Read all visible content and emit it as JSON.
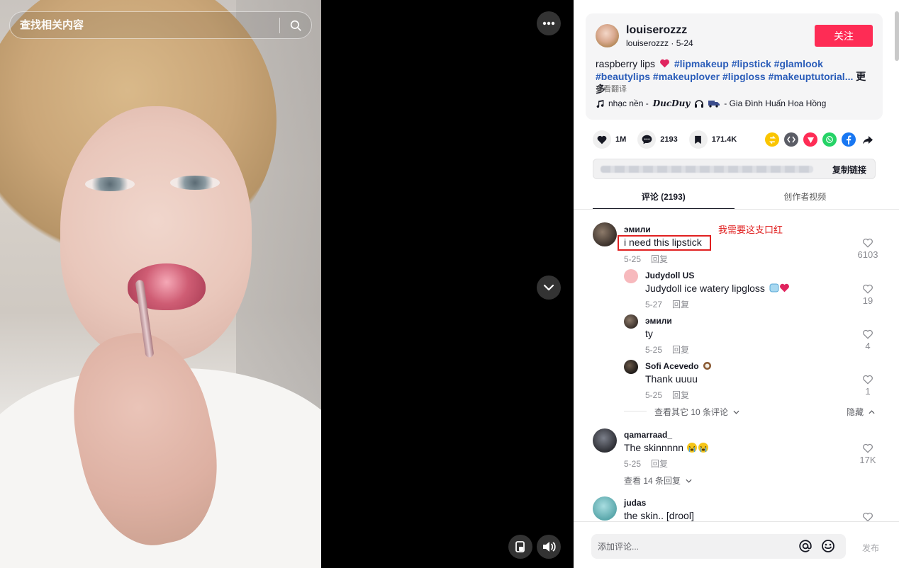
{
  "search": {
    "placeholder": "查找相关内容"
  },
  "video": {
    "controls": {
      "more_icon": "more-icon",
      "next_icon": "chevron-down-icon",
      "pip_icon": "pip-icon",
      "volume_icon": "volume-icon"
    }
  },
  "author": {
    "name": "louiserozzz",
    "sub": "louiserozzz · 5-24",
    "follow_label": "关注"
  },
  "description": {
    "text": "raspberry lips",
    "hashtags": [
      "#lipmakeup",
      "#lipstick",
      "#glamlook",
      "#beautylips",
      "#makeuplover",
      "#lipgloss",
      "#makeuptutorial..."
    ],
    "more_label": "更多",
    "translate_label": "查看翻译"
  },
  "music": {
    "prefix": "nhạc nền -",
    "dj": "DucDuy",
    "suffix": "- Gia Đình Huấn Hoa Hồng"
  },
  "stats": {
    "likes": "1M",
    "comments": "2193",
    "saves": "171.4K"
  },
  "share_icons": [
    "repost-icon",
    "embed-icon",
    "direct-share-icon",
    "whatsapp-icon",
    "facebook-icon",
    "share-arrow-icon"
  ],
  "colors": {
    "accent": "#fe2c55",
    "hashtag": "#2b5db9",
    "annotation": "#e02020"
  },
  "link": {
    "copy_label": "复制链接"
  },
  "tabs": [
    {
      "label": "评论 (2193)",
      "active": true
    },
    {
      "label": "创作者视频",
      "active": false
    }
  ],
  "comments": {
    "c1": {
      "name": "эмили",
      "text": "i need this lipstick",
      "date": "5-25",
      "reply": "回复",
      "likes": "6103",
      "annotation": "我需要这支口红"
    },
    "r1": {
      "name": "Judydoll US",
      "text": "Judydoll ice watery lipgloss",
      "date": "5-27",
      "reply": "回复",
      "likes": "19"
    },
    "r2": {
      "name": "эмили",
      "text": "ty",
      "date": "5-25",
      "reply": "回复",
      "likes": "4"
    },
    "r3": {
      "name": "Sofi Acevedo",
      "text": "Thank uuuu",
      "date": "5-25",
      "reply": "回复",
      "likes": "1"
    },
    "view_more_replies": "查看其它 10 条评论",
    "hide_label": "隐藏",
    "c2": {
      "name": "qamarraad_",
      "text": "The skinnnnn",
      "date": "5-25",
      "reply": "回复",
      "likes": "17K",
      "view_replies": "查看 14 条回复"
    },
    "c3": {
      "name": "judas",
      "text": "the skin.. [drool]"
    }
  },
  "composer": {
    "placeholder": "添加评论...",
    "post_label": "发布"
  }
}
